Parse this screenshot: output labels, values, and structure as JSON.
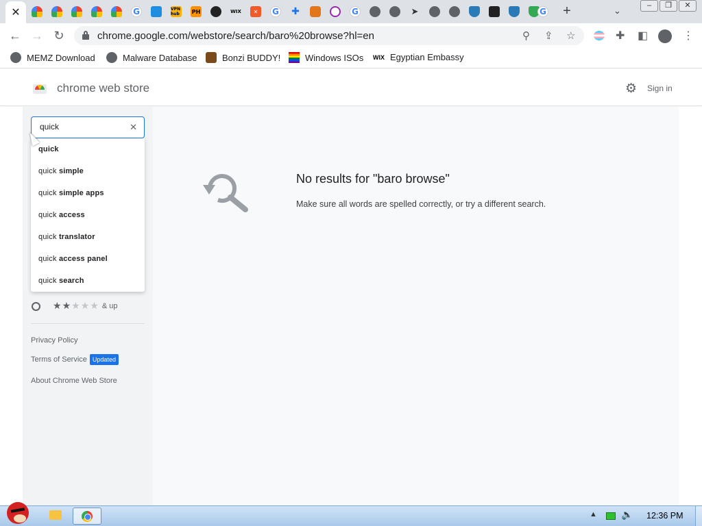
{
  "browser": {
    "tabs": [
      {
        "icon": "close-icon",
        "active": true
      },
      {
        "icon": "webstore-rainbow-icon"
      },
      {
        "icon": "webstore-rainbow-icon"
      },
      {
        "icon": "webstore-rainbow-icon"
      },
      {
        "icon": "webstore-rainbow-icon"
      },
      {
        "icon": "webstore-rainbow-icon"
      },
      {
        "icon": "google-icon"
      },
      {
        "icon": "blue-app-icon"
      },
      {
        "icon": "vpn-hub-icon",
        "text": "VPN hub"
      },
      {
        "icon": "ph-icon",
        "text": "PH"
      },
      {
        "icon": "dark-circle-icon"
      },
      {
        "icon": "wix-icon",
        "text": "WIX"
      },
      {
        "icon": "orange-x-icon"
      },
      {
        "icon": "google-icon"
      },
      {
        "icon": "puzzle-icon"
      },
      {
        "icon": "metamask-fox-icon"
      },
      {
        "icon": "purple-ring-icon"
      },
      {
        "icon": "google-icon"
      },
      {
        "icon": "globe-icon"
      },
      {
        "icon": "globe-icon"
      },
      {
        "icon": "arrow-cursor-icon"
      },
      {
        "icon": "globe-icon"
      },
      {
        "icon": "globe-icon"
      },
      {
        "icon": "shield-icon"
      },
      {
        "icon": "dark-app-icon"
      },
      {
        "icon": "shield-icon"
      },
      {
        "icon": "green-shield-icon"
      },
      {
        "icon": "google-icon"
      }
    ],
    "address": "chrome.google.com/webstore/search/baro%20browse?hl=en",
    "bookmarks": [
      {
        "label": "MEMZ Download",
        "icon": "globe-icon"
      },
      {
        "label": "Malware Database",
        "icon": "globe-icon"
      },
      {
        "label": "Bonzi BUDDY!",
        "icon": "bonzi-icon"
      },
      {
        "label": "Windows ISOs",
        "icon": "rainbow-flag-icon"
      },
      {
        "label": "Egyptian Embassy",
        "icon": "wix-icon",
        "icon_text": "WIX"
      }
    ]
  },
  "store": {
    "title": "chrome web store",
    "signin": "Sign in",
    "search": {
      "value": "quick ",
      "suggestions": [
        {
          "prefix": "quick",
          "rest": ""
        },
        {
          "prefix": "quick ",
          "rest": "simple"
        },
        {
          "prefix": "quick ",
          "rest": "simple apps"
        },
        {
          "prefix": "quick ",
          "rest": "access"
        },
        {
          "prefix": "quick ",
          "rest": "translator"
        },
        {
          "prefix": "quick ",
          "rest": "access panel"
        },
        {
          "prefix": "quick ",
          "rest": "search"
        }
      ]
    },
    "rating_filter": {
      "stars_on": 2,
      "stars_total": 5,
      "label": "& up"
    },
    "links": {
      "privacy": "Privacy Policy",
      "terms": "Terms of Service",
      "terms_badge": "Updated",
      "about": "About Chrome Web Store"
    },
    "results": {
      "title": "No results for \"baro browse\"",
      "subtitle": "Make sure all words are spelled correctly, or try a different search."
    }
  },
  "taskbar": {
    "clock": "12:36 PM"
  }
}
